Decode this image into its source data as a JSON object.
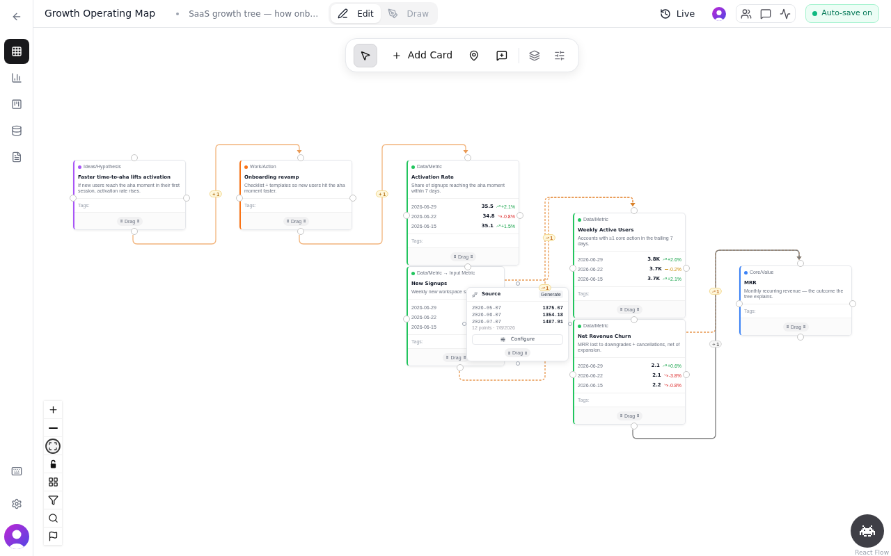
{
  "sidebar": {
    "items": [
      {
        "selected": true
      },
      {
        "selected": false
      },
      {
        "selected": false
      },
      {
        "selected": false
      },
      {
        "selected": false
      }
    ]
  },
  "header": {
    "title": "Growth Operating Map",
    "subtitle": "SaaS growth tree — how onb…",
    "modes": [
      {
        "label": "Edit",
        "selected": true
      },
      {
        "label": "Draw",
        "selected": false
      }
    ],
    "live": "Live",
    "autosave": {
      "label": "Auto-save on",
      "on": true
    }
  },
  "toolbar": {
    "pointer_selected": true,
    "add_card": "Add Card"
  },
  "nodes": [
    {
      "kind": "card",
      "category": "Ideas/Hypothesis",
      "color": "#a855f7",
      "title": "Faster time-to-aha lifts activation",
      "description": "If new users reach the aha moment in their first session, activation rate rises.",
      "tags_label": "Tags:",
      "drag_label": "Drag"
    },
    {
      "kind": "card",
      "category": "Work/Action",
      "color": "#f97316",
      "title": "Onboarding revamp",
      "description": "Checklist + templates so new users hit the aha moment faster.",
      "tags_label": "Tags:",
      "drag_label": "Drag"
    },
    {
      "kind": "card",
      "category": "Data/Metric",
      "color": "#22c55e",
      "title": "Activation Rate",
      "description": "Share of signups reaching the aha moment within 7 days.",
      "metrics": [
        {
          "kind": "up",
          "date": "2026-06-29",
          "value": "35.5",
          "change": "+2.1%"
        },
        {
          "kind": "down",
          "date": "2026-06-22",
          "value": "34.8",
          "change": "-0.8%"
        },
        {
          "kind": "up",
          "date": "2026-06-15",
          "value": "35.1",
          "change": "+1.5%"
        }
      ],
      "tags_label": "Tags:",
      "drag_label": "Drag"
    },
    {
      "kind": "card",
      "category": "Data/Metric → Input Metric",
      "color": "#22c55e",
      "title": "New Signups",
      "description": "Weekly new workspace s",
      "metrics": [
        {
          "date": "2026-06-29"
        },
        {
          "date": "2026-06-22"
        },
        {
          "date": "2026-06-15"
        }
      ],
      "tags_label": "Tags:",
      "drag_label": "Drag"
    },
    {
      "kind": "source",
      "title": "Source",
      "action": "Generate",
      "points": [
        {
          "date": "2026-05-07",
          "value": "1375.67"
        },
        {
          "date": "2026-06-07",
          "value": "1354.18"
        },
        {
          "date": "2026-07-07",
          "value": "1487.91"
        }
      ],
      "footnote": "12 points · 7/8/2026",
      "configure": "Configure",
      "drag_label": "Drag"
    },
    {
      "kind": "card",
      "category": "Data/Metric",
      "color": "#22c55e",
      "title": "Weekly Active Users",
      "description": "Accounts with ≥1 core action in the trailing 7 days.",
      "metrics": [
        {
          "kind": "up",
          "date": "2026-06-29",
          "value": "3.8K",
          "change": "+2.6%"
        },
        {
          "kind": "flat",
          "date": "2026-06-22",
          "value": "3.7K",
          "change": "-0.2%"
        },
        {
          "kind": "up",
          "date": "2026-06-15",
          "value": "3.7K",
          "change": "+2.1%"
        }
      ],
      "tags_label": "Tags:",
      "drag_label": "Drag"
    },
    {
      "kind": "card",
      "category": "Data/Metric",
      "color": "#22c55e",
      "title": "Net Revenue Churn",
      "description": "MRR lost to downgrades + cancellations, net of expansion.",
      "metrics": [
        {
          "kind": "up",
          "date": "2026-06-29",
          "value": "2.1",
          "change": "+0.6%"
        },
        {
          "kind": "down",
          "date": "2026-06-22",
          "value": "2.1",
          "change": "-3.8%"
        },
        {
          "kind": "down",
          "date": "2026-06-15",
          "value": "2.2",
          "change": "-0.8%"
        }
      ],
      "tags_label": "Tags:",
      "drag_label": "Drag"
    },
    {
      "kind": "card",
      "category": "Core/Value",
      "color": "#3b82f6",
      "title": "MRR",
      "description": "Monthly recurring revenue — the outcome the tree explains.",
      "tags_label": "Tags:",
      "drag_label": "Drag"
    }
  ],
  "edges": [
    {
      "kind": "action",
      "label": "1"
    },
    {
      "kind": "action",
      "label": "1"
    },
    {
      "kind": "metric",
      "label": "1"
    },
    {
      "kind": "metric",
      "label": "1"
    },
    {
      "kind": "metric",
      "label": "1"
    },
    {
      "kind": "value",
      "label": "1"
    }
  ],
  "attribution": "React Flow"
}
